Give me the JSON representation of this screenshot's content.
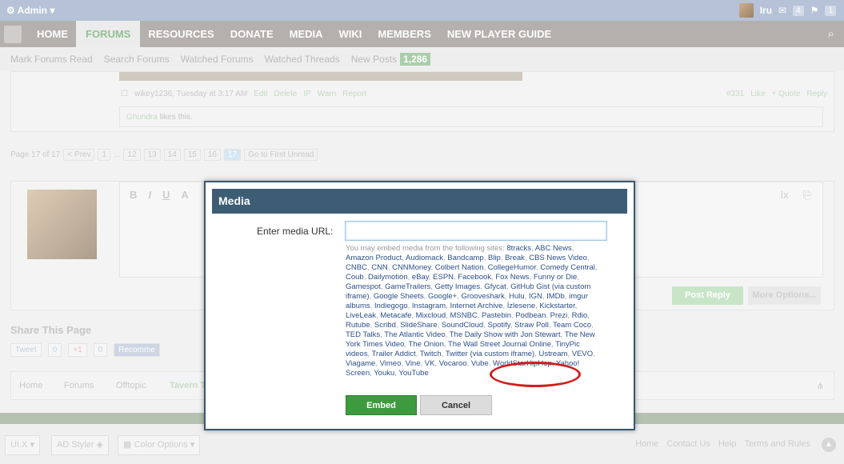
{
  "adminbar": {
    "label": "Admin",
    "user": "Iru",
    "inbox_count": "4",
    "alerts_count": "1"
  },
  "nav": {
    "tabs": [
      "HOME",
      "FORUMS",
      "RESOURCES",
      "DONATE",
      "MEDIA",
      "WIKI",
      "MEMBERS",
      "NEW PLAYER GUIDE"
    ],
    "active": "FORUMS"
  },
  "subnav": {
    "items": [
      "Mark Forums Read",
      "Search Forums",
      "Watched Forums",
      "Watched Threads"
    ],
    "new_posts": "New Posts",
    "new_posts_count": "1,286"
  },
  "post": {
    "author_time": "wikey1236, Tuesday at 3:17 AM",
    "actions": [
      "Edit",
      "Delete",
      "IP",
      "Warn",
      "Report"
    ],
    "right": [
      "#331",
      "Like",
      "+ Quote",
      "Reply"
    ],
    "likes_user": "Ghundra",
    "likes_text": " likes this."
  },
  "pagenav": {
    "label": "Page 17 of 17",
    "prev": "< Prev",
    "pages": [
      "1",
      "...",
      "12",
      "13",
      "14",
      "15",
      "16",
      "17"
    ],
    "first_unread": "Go to First Unread"
  },
  "editor": {
    "tools": [
      "B",
      "I",
      "U",
      "A"
    ],
    "post_reply": "Post Reply",
    "more_options": "More Options..."
  },
  "share": {
    "title": "Share This Page",
    "tweet": "Tweet",
    "tweet_count": "0",
    "gplus": "+1",
    "gplus_count": "0",
    "facebook": "Recomme"
  },
  "crumbs": [
    "Home",
    "Forums",
    "Offtopic",
    "Tavern T"
  ],
  "footer": {
    "style": "UI.X",
    "ad_styler": "AD Styler",
    "color_options": "Color Options",
    "links": [
      "Home",
      "Contact Us",
      "Help",
      "Terms and Rules"
    ]
  },
  "modal": {
    "title": "Media",
    "url_label": "Enter media URL:",
    "url_value": "",
    "intro": "You may embed media from the following sites: ",
    "sites": [
      "8tracks",
      "ABC News",
      "Amazon Product",
      "Audiomack",
      "Bandcamp",
      "Blip",
      "Break",
      "CBS News Video",
      "CNBC",
      "CNN",
      "CNNMoney",
      "Colbert Nation",
      "CollegeHumor",
      "Comedy Central",
      "Coub",
      "Dailymotion",
      "eBay",
      "ESPN",
      "Facebook",
      "Fox News",
      "Funny or Die",
      "Gamespot",
      "GameTrailers",
      "Getty Images",
      "Gfycat",
      "GitHub Gist (via custom iframe)",
      "Google Sheets",
      "Google+",
      "Grooveshark",
      "Hulu",
      "IGN",
      "IMDb",
      "imgur albums",
      "Indiegogo",
      "Instagram",
      "Internet Archive",
      "İzlesene",
      "Kickstarter",
      "LiveLeak",
      "Metacafe",
      "Mixcloud",
      "MSNBC",
      "Pastebin",
      "Podbean",
      "Prezi",
      "Rdio",
      "Rutube",
      "Scribd",
      "SlideShare",
      "SoundCloud",
      "Spotify",
      "Straw Poll",
      "Team Coco",
      "TED Talks",
      "The Atlantic Video",
      "The Daily Show with Jon Stewart",
      "The New York Times Video",
      "The Onion",
      "The Wall Street Journal Online",
      "TinyPic videos",
      "Trailer Addict",
      "Twitch",
      "Twitter (via custom iframe)",
      "Ustream",
      "VEVO",
      "Viagame",
      "Vimeo",
      "Vine",
      "VK",
      "Vocaroo",
      "Vube",
      "WorldStarHipHop",
      "Yahoo! Screen",
      "Youku",
      "YouTube"
    ],
    "embed": "Embed",
    "cancel": "Cancel"
  }
}
